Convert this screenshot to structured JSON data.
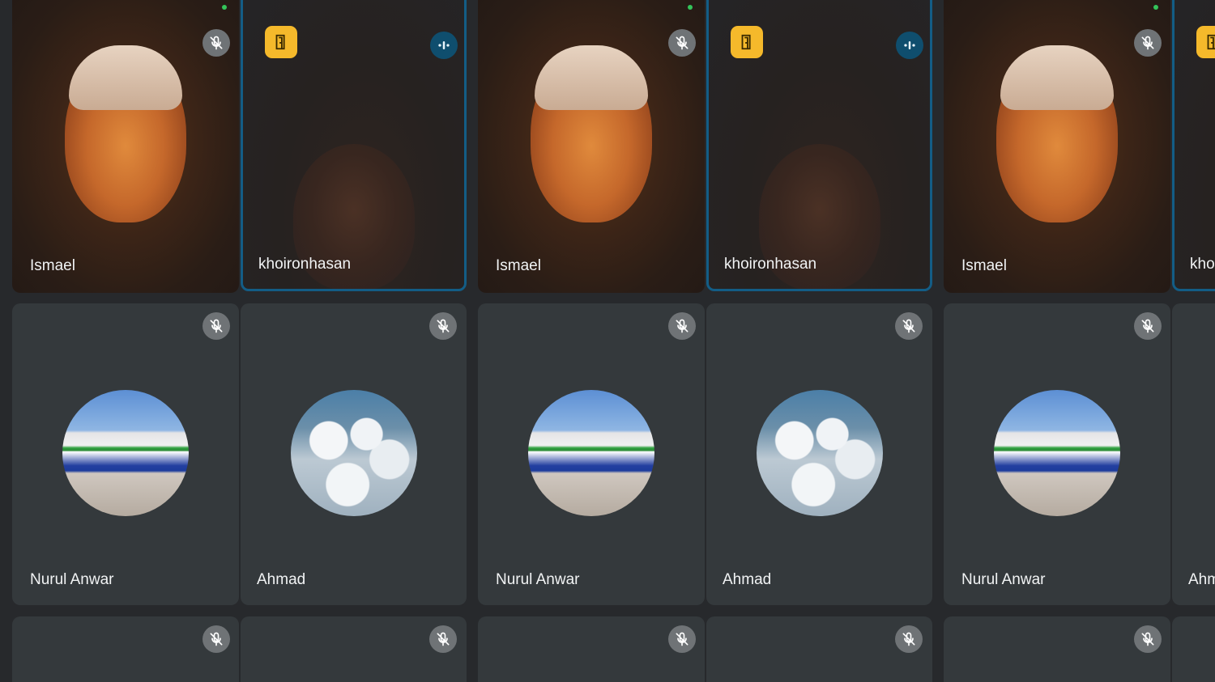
{
  "participants": [
    {
      "name": "Ismael"
    },
    {
      "name": "khoironhasan"
    },
    {
      "name": "Nurul Anwar"
    },
    {
      "name": "Ahmad"
    }
  ],
  "row1": [
    "Ismael",
    "khoironhasan",
    "Ismael",
    "khoironhasan",
    "Ismael",
    "khoironhasan"
  ],
  "row2": [
    "Nurul Anwar",
    "Ahmad",
    "Nurul Anwar",
    "Ahmad",
    "Nurul Anwar",
    "Ahmad"
  ],
  "icons": {
    "muted": "mic-off-icon",
    "speaking": "audio-level-icon",
    "host": "door-exit-icon",
    "presence": "green-status-dot"
  },
  "colors": {
    "tile_bg": "#34393c",
    "speaking_border": "#135d86",
    "host_badge": "#f5b92b",
    "mic_off_bg": "#6f7376",
    "presence_dot": "#34c45a"
  }
}
